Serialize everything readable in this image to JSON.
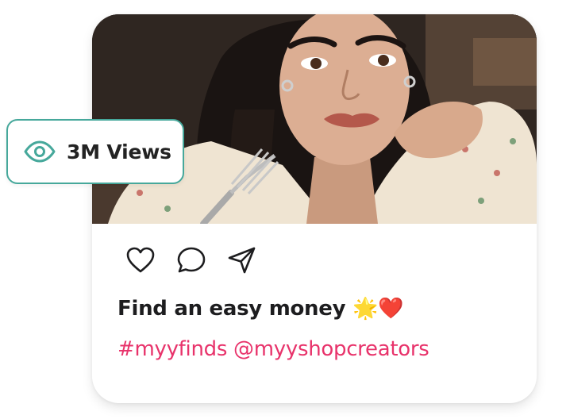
{
  "post": {
    "photo": {
      "alt": "woman-resting-chin-on-hand-with-fork"
    },
    "actions": [
      {
        "name": "like",
        "icon": "heart-icon"
      },
      {
        "name": "comment",
        "icon": "comment-icon"
      },
      {
        "name": "share",
        "icon": "send-icon"
      }
    ],
    "caption": "Find an easy money ",
    "caption_emoji": "🌟❤️",
    "hashtags": "#myyfinds @myyshopcreators"
  },
  "views_badge": {
    "icon": "eye-icon",
    "label": "3M Views"
  },
  "colors": {
    "accent_teal": "#46a89b",
    "hashtag_pink": "#e8336b",
    "text_dark": "#1d1d1f"
  }
}
